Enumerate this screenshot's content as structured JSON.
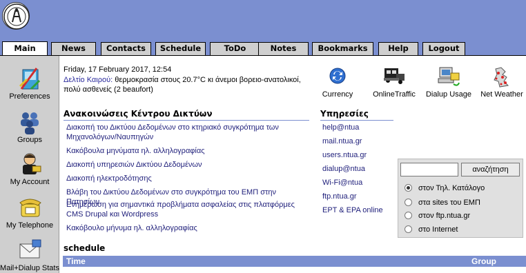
{
  "tabs": [
    {
      "label": "Main",
      "active": true
    },
    {
      "label": "News"
    },
    {
      "label": "Contacts"
    },
    {
      "label": "Schedule"
    },
    {
      "label": "ToDo"
    },
    {
      "label": "Notes"
    },
    {
      "label": "Bookmarks"
    },
    {
      "label": "Help"
    },
    {
      "label": "Logout"
    }
  ],
  "sidebar": {
    "items": [
      {
        "label": "Preferences",
        "icon": "preferences-icon"
      },
      {
        "label": "Groups",
        "icon": "groups-icon"
      },
      {
        "label": "My Account",
        "icon": "account-icon"
      },
      {
        "label": "My Telephone",
        "icon": "telephone-icon"
      },
      {
        "label": "Mail+Dialup Stats",
        "icon": "mail-stats-icon"
      }
    ]
  },
  "main": {
    "date": "Friday, 17 February 2017, 12:54",
    "weather_link": "Δελτίο Καιρού:",
    "weather_text": " θερμοκρασία στους 20.7°C κι άνεμοι βορειο-ανατολικοί, πολύ ασθενείς (2 beaufort)"
  },
  "shortcuts": [
    {
      "label": "Currency",
      "icon": "currency-icon"
    },
    {
      "label": "OnlineTraffic",
      "icon": "traffic-icon"
    },
    {
      "label": "Dialup Usage",
      "icon": "dialup-icon"
    },
    {
      "label": "Net Weather",
      "icon": "net-weather-icon"
    }
  ],
  "news": {
    "title": "Ανακοινώσεις Κέντρου Δικτύων",
    "items": [
      "Διακοπή του Δικτύου Δεδομένων στο κτηριακό συγκρότημα των Μηχανολόγων/Ναυπηγών",
      "Κακόβουλα μηνύματα ηλ. αλληλογραφίας",
      "Διακοπή υπηρεσιών Δικτύου Δεδομένων",
      "Διακοπή ηλεκτροδότησης",
      "Βλάβη του Δικτύου Δεδομένων στο συγκρότημα του ΕΜΠ στην Πατησίων",
      "Ενημέρωση για σημαντικά προβλήματα ασφαλείας στις πλατφόρμες CMS Drupal και Wordpress",
      "Κακόβουλο μήνυμα ηλ. αλληλογραφίας"
    ]
  },
  "services": {
    "title": "Υπηρεσίες",
    "items": [
      "help@ntua",
      "mail.ntua.gr",
      "users.ntua.gr",
      "dialup@ntua",
      "Wi-Fi@ntua",
      "ftp.ntua.gr",
      "EPT & EPA online"
    ]
  },
  "search": {
    "input_value": "",
    "button_label": "αναζήτηση",
    "options": [
      {
        "label": "στον Τηλ. Κατάλογο",
        "checked": true
      },
      {
        "label": "στα sites του ΕΜΠ",
        "checked": false
      },
      {
        "label": "στον ftp.ntua.gr",
        "checked": false
      },
      {
        "label": "στο Internet",
        "checked": false
      }
    ]
  },
  "schedule": {
    "title": "schedule",
    "col_time": "Time",
    "col_group": "Group"
  },
  "colors": {
    "header": "#7b8fd0",
    "tab": "#cfcfcf",
    "link": "#1e1e7a"
  }
}
